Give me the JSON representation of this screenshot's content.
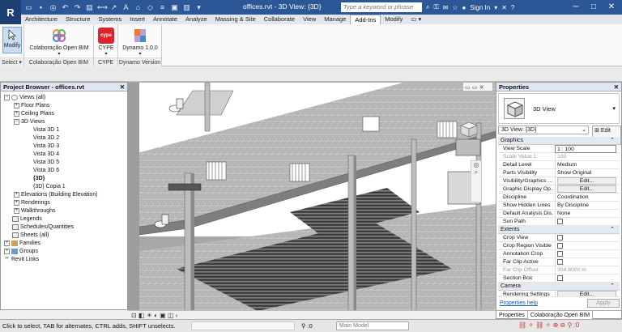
{
  "app": {
    "logo": "R",
    "doc_title": "offices.rvt - 3D View: {3D}",
    "search_placeholder": "Type a keyword or phrase",
    "sign_in": "Sign In",
    "help": "?"
  },
  "tabs": [
    "Architecture",
    "Structure",
    "Systems",
    "Insert",
    "Annotate",
    "Analyze",
    "Massing & Site",
    "Collaborate",
    "View",
    "Manage",
    "Add-Ins",
    "Modify"
  ],
  "active_tab": "Add-Ins",
  "ribbon": {
    "modify_label": "Modify",
    "select_label": "Select ▾",
    "open_bim_label": "Colaboração Open BIM",
    "open_bim_group": "Colaboração Open BIM",
    "cype_label": "CYPE",
    "cype_group": "CYPE",
    "cype_icon_text": "cype",
    "dynamo_label": "Dynamo 1.0.0",
    "dynamo_group": "Dynamo Version"
  },
  "project_browser": {
    "title": "Project Browser - offices.rvt",
    "items": [
      {
        "label": "Views (all)",
        "toggle": "−"
      },
      {
        "label": "Floor Plans",
        "toggle": "+"
      },
      {
        "label": "Ceiling Plans",
        "toggle": "+"
      },
      {
        "label": "3D Views",
        "toggle": "−"
      },
      {
        "label": "Vista 3D 1"
      },
      {
        "label": "Vista 3D 2"
      },
      {
        "label": "Vista 3D 3"
      },
      {
        "label": "Vista 3D 4"
      },
      {
        "label": "Vista 3D 5"
      },
      {
        "label": "Vista 3D 6"
      },
      {
        "label": "{3D}"
      },
      {
        "label": "{3D} Copia 1"
      },
      {
        "label": "Elevations (Building Elevation)",
        "toggle": "+"
      },
      {
        "label": "Renderings",
        "toggle": "+"
      },
      {
        "label": "Walkthroughs",
        "toggle": "+"
      },
      {
        "label": "Legends"
      },
      {
        "label": "Schedules/Quantities"
      },
      {
        "label": "Sheets (all)"
      },
      {
        "label": "Families",
        "toggle": "+"
      },
      {
        "label": "Groups",
        "toggle": "+"
      },
      {
        "label": "Revit Links"
      }
    ]
  },
  "properties": {
    "title": "Properties",
    "type_name": "3D View",
    "view_selector": "3D View: {3D}",
    "edit_type": "Edit Type",
    "sections": {
      "graphics": "Graphics",
      "extents": "Extents",
      "camera": "Camera"
    },
    "rows": {
      "view_scale": {
        "k": "View Scale",
        "v": "1 : 100"
      },
      "scale_value": {
        "k": "Scale Value   1:",
        "v": "100"
      },
      "detail_level": {
        "k": "Detail Level",
        "v": "Medium"
      },
      "parts_visibility": {
        "k": "Parts Visibility",
        "v": "Show Original"
      },
      "vis_graphics": {
        "k": "Visibility/Graphics ...",
        "v": "Edit..."
      },
      "graphic_display": {
        "k": "Graphic Display Op...",
        "v": "Edit..."
      },
      "discipline": {
        "k": "Discipline",
        "v": "Coordination"
      },
      "hidden_lines": {
        "k": "Show Hidden Lines",
        "v": "By Discipline"
      },
      "analysis_display": {
        "k": "Default Analysis Dis...",
        "v": "None"
      },
      "sun_path": {
        "k": "Sun Path"
      },
      "crop_view": {
        "k": "Crop View"
      },
      "crop_visible": {
        "k": "Crop Region Visible"
      },
      "annotation_crop": {
        "k": "Annotation Crop"
      },
      "far_clip_active": {
        "k": "Far Clip Active"
      },
      "far_clip_offset": {
        "k": "Far Clip Offset",
        "v": "304.8000 m"
      },
      "section_box": {
        "k": "Section Box"
      },
      "rendering_settings": {
        "k": "Rendering Settings",
        "v": "Edit..."
      }
    },
    "help_link": "Properties help",
    "apply": "Apply",
    "tabs": [
      "Properties",
      "Colaboração Open BIM"
    ]
  },
  "status": {
    "text": "Click to select, TAB for alternates, CTRL adds, SHIFT unselects.",
    "zero": ":0",
    "model": "Main Model"
  }
}
